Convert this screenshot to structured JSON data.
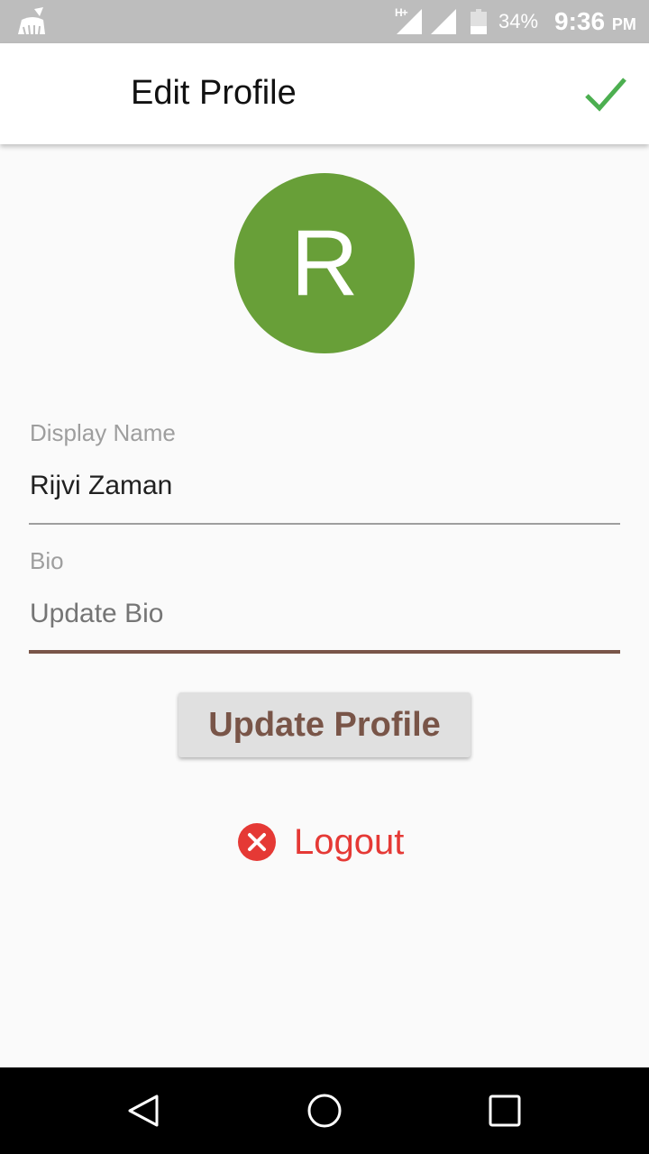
{
  "status_bar": {
    "network_type": "H+",
    "battery_percent": "34%",
    "time": "9:36",
    "ampm": "PM"
  },
  "app_bar": {
    "title": "Edit Profile",
    "confirm_icon": "check-icon",
    "accent_color": "#4caf50"
  },
  "avatar": {
    "initial": "R",
    "color": "#689f38"
  },
  "form": {
    "display_name": {
      "label": "Display Name",
      "value": "Rijvi Zaman"
    },
    "bio": {
      "label": "Bio",
      "value": "",
      "placeholder": "Update Bio"
    }
  },
  "actions": {
    "update_label": "Update Profile",
    "logout_label": "Logout",
    "logout_icon": "close-circle-icon",
    "logout_color": "#e53935"
  },
  "nav_bar": {
    "back_icon": "back-icon",
    "home_icon": "home-icon",
    "recents_icon": "recents-icon"
  }
}
